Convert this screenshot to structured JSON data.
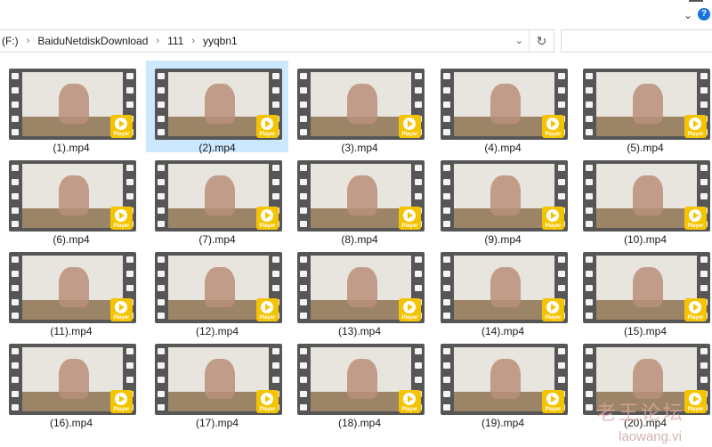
{
  "addressbar": {
    "crumbs": [
      "(F:)",
      "BaiduNetdiskDownload",
      "111",
      "yyqbn1"
    ],
    "dropdown_icon": "chevron-down-icon",
    "refresh_icon": "refresh-icon",
    "search_placeholder": ""
  },
  "topbar": {
    "collapse_icon": "chevron-down-icon",
    "help_icon": "?"
  },
  "badge_text": "Player",
  "files": [
    {
      "name": "(1).mp4"
    },
    {
      "name": "(2).mp4",
      "selected": true
    },
    {
      "name": "(3).mp4"
    },
    {
      "name": "(4).mp4"
    },
    {
      "name": "(5).mp4"
    },
    {
      "name": "(6).mp4"
    },
    {
      "name": "(7).mp4"
    },
    {
      "name": "(8).mp4"
    },
    {
      "name": "(9).mp4"
    },
    {
      "name": "(10).mp4"
    },
    {
      "name": "(11).mp4"
    },
    {
      "name": "(12).mp4"
    },
    {
      "name": "(13).mp4"
    },
    {
      "name": "(14).mp4"
    },
    {
      "name": "(15).mp4"
    },
    {
      "name": "(16).mp4"
    },
    {
      "name": "(17).mp4"
    },
    {
      "name": "(18).mp4"
    },
    {
      "name": "(19).mp4"
    },
    {
      "name": "(20).mp4"
    }
  ],
  "watermark": {
    "line1": "老王论坛",
    "line2": "laowang.vi"
  },
  "colors": {
    "accent": "#1a73d9",
    "selection": "#cce8ff",
    "badge": "#f5c400",
    "film": "#565656"
  }
}
